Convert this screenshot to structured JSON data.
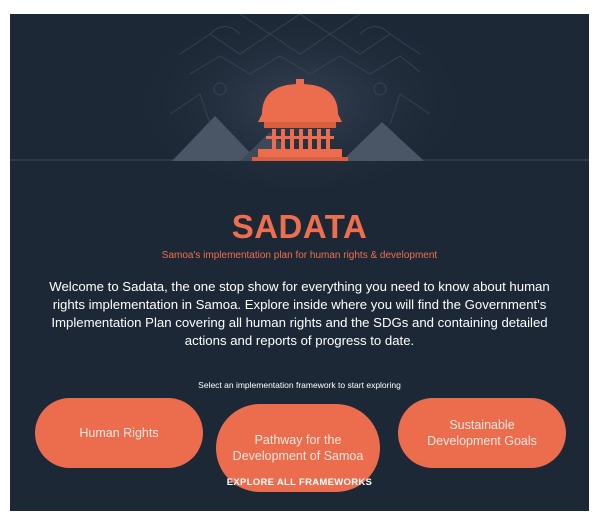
{
  "header": {
    "title": "SADATA",
    "subtitle": "Samoa's implementation plan for human rights & development"
  },
  "intro": {
    "text": "Welcome to Sadata, the one stop show for everything you need to know about human rights implementation in Samoa. Explore inside where you will find the Government's Implementation Plan covering all human rights and the SDGs and containing detailed actions and reports of progress to date."
  },
  "frameworks": {
    "prompt": "Select an implementation framework to start exploring",
    "buttons": [
      {
        "label": "Human Rights"
      },
      {
        "label": "Pathway for the Development of Samoa"
      },
      {
        "label": "Sustainable Development Goals"
      }
    ],
    "explore_all": "EXPLORE ALL FRAMEWORKS"
  },
  "colors": {
    "background": "#1d2837",
    "accent": "#ec6d4e",
    "text": "#ffffff"
  },
  "icons": {
    "hero": "samoan-fale-illustration"
  }
}
